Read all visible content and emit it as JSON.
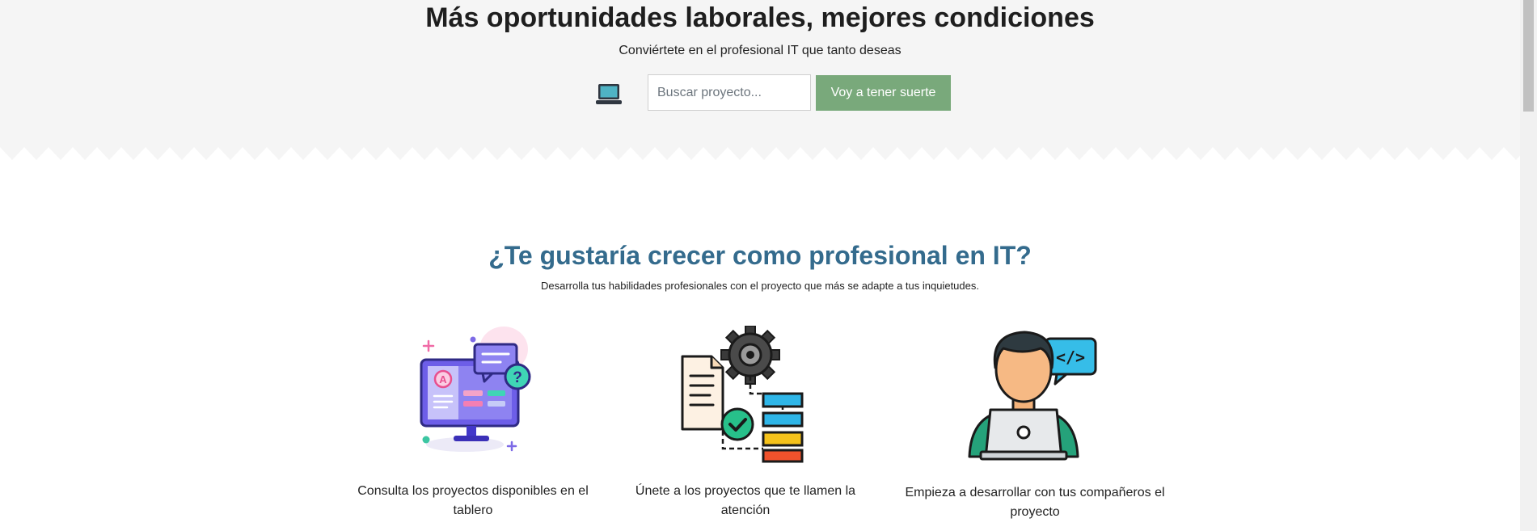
{
  "hero": {
    "title": "Más oportunidades laborales, mejores condiciones",
    "subtitle": "Conviértete en el profesional IT que tanto deseas",
    "search": {
      "placeholder": "Buscar proyecto...",
      "button_label": "Voy a tener suerte"
    },
    "icon": "laptop-icon"
  },
  "section": {
    "title": "¿Te gustaría crecer como profesional en IT?",
    "subtitle": "Desarrolla tus habilidades profesionales con el proyecto que más se adapte a tus inquietudes."
  },
  "features": [
    {
      "icon": "project-board-monitor-icon",
      "caption": "Consulta los proyectos disponibles en el tablero"
    },
    {
      "icon": "workflow-gear-icon",
      "caption": "Únete a los proyectos que te llamen la atención"
    },
    {
      "icon": "developer-laptop-icon",
      "caption": "Empieza a desarrollar con tus compañeros el proyecto"
    }
  ],
  "colors": {
    "hero_background": "#f5f5f5",
    "button": "#79a97b",
    "section_title": "#346b8d"
  }
}
